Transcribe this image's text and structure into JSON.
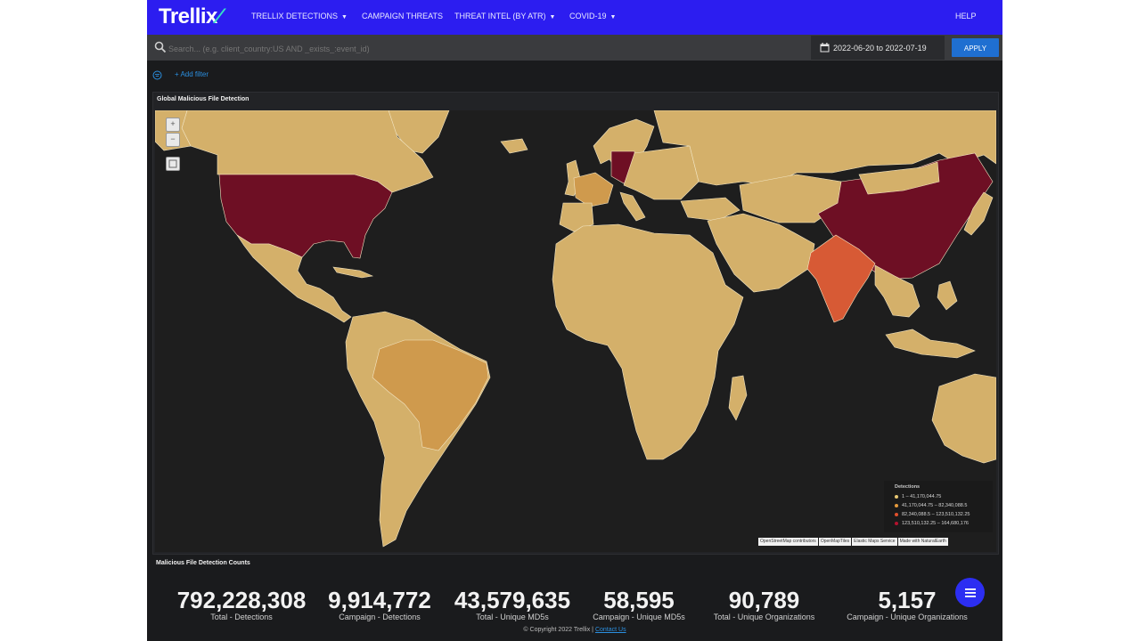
{
  "nav": {
    "logo": "Trellix",
    "items": [
      {
        "label": "TRELLIX DETECTIONS",
        "dropdown": true
      },
      {
        "label": "CAMPAIGN THREATS",
        "dropdown": false
      },
      {
        "label": "THREAT INTEL (BY ATR)",
        "dropdown": true
      },
      {
        "label": "COVID-19",
        "dropdown": true
      }
    ],
    "help": "HELP"
  },
  "search": {
    "placeholder": "Search... (e.g. client_country:US AND _exists_:event_id)",
    "value": "",
    "date_range": "2022-06-20 to 2022-07-19",
    "apply_label": "APPLY"
  },
  "filter": {
    "add_label": "+ Add filter"
  },
  "map_panel": {
    "title": "Global Malicious File Detection",
    "legend": {
      "title": "Detections",
      "items": [
        {
          "label": "1 – 41,170,044.75",
          "color": "#e8c772"
        },
        {
          "label": "41,170,044.75 – 82,340,088.5",
          "color": "#e49a3c"
        },
        {
          "label": "82,340,088.5 – 123,510,132.25",
          "color": "#e0502c"
        },
        {
          "label": "123,510,132.25 – 164,680,176",
          "color": "#b3122e"
        }
      ]
    },
    "attribution": [
      "OpenStreetMap contributors",
      "OpenMapTiles",
      "Elastic Maps Service",
      "Made with NaturalEarth"
    ],
    "colors": {
      "ocean": "#1e1e1e",
      "low": "#d4b06a",
      "mid_low": "#cf9a4d",
      "mid_high": "#d75a35",
      "high": "#6e0f24",
      "border": "#f3e6c4"
    }
  },
  "counts": {
    "title": "Malicious File Detection Counts",
    "metrics": [
      {
        "value": "792,228,308",
        "label": "Total - Detections"
      },
      {
        "value": "9,914,772",
        "label": "Campaign - Detections"
      },
      {
        "value": "43,579,635",
        "label": "Total - Unique MD5s"
      },
      {
        "value": "58,595",
        "label": "Campaign - Unique MD5s"
      },
      {
        "value": "90,789",
        "label": "Total - Unique Organizations"
      },
      {
        "value": "5,157",
        "label": "Campaign - Unique Organizations"
      }
    ]
  },
  "footer": {
    "copyright": "© Copyright 2022 Trellix |",
    "contact": "Contact Us"
  }
}
